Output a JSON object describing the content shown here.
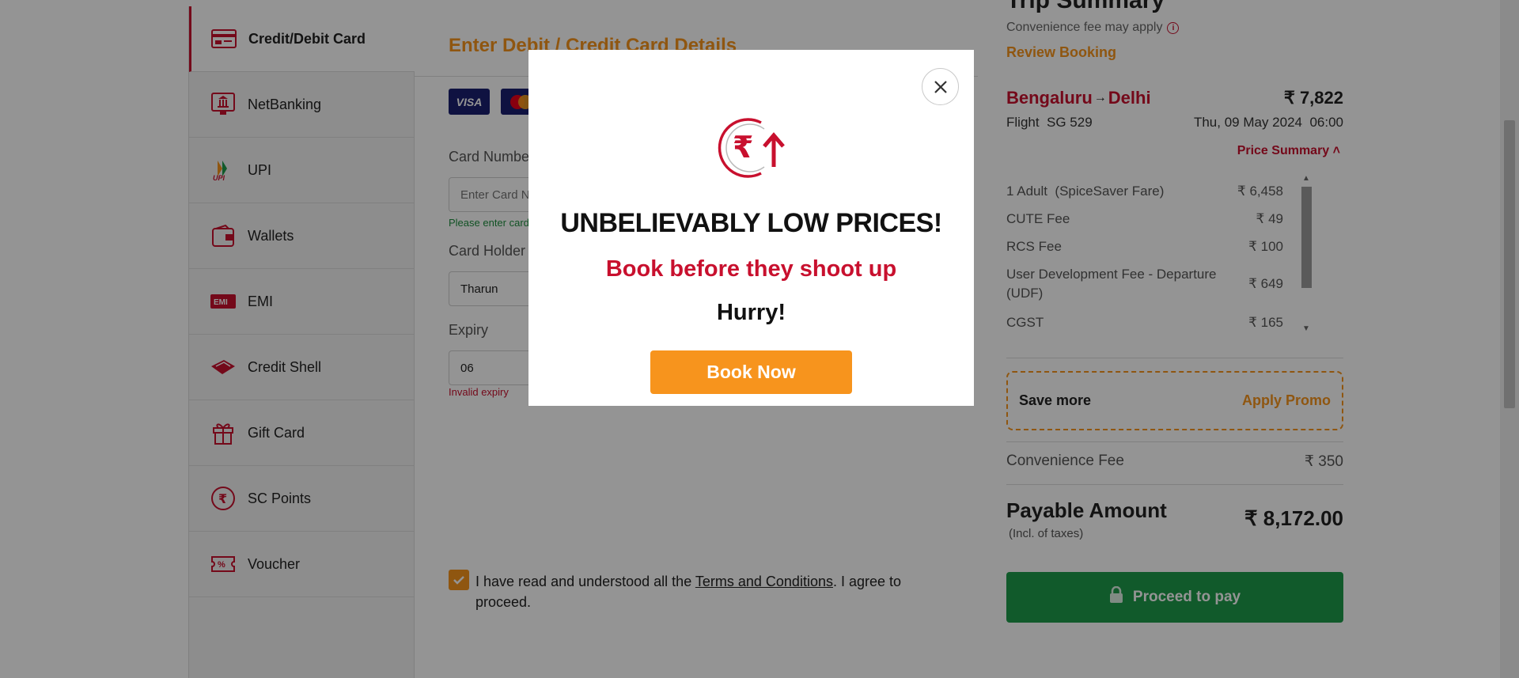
{
  "payment_methods": [
    {
      "label": "Credit/Debit Card",
      "icon": "credit-card-icon",
      "active": true
    },
    {
      "label": "NetBanking",
      "icon": "bank-icon",
      "active": false
    },
    {
      "label": "UPI",
      "icon": "upi-icon",
      "active": false
    },
    {
      "label": "Wallets",
      "icon": "wallet-icon",
      "active": false
    },
    {
      "label": "EMI",
      "icon": "emi-icon",
      "active": false
    },
    {
      "label": "Credit Shell",
      "icon": "credit-shell-icon",
      "active": false
    },
    {
      "label": "Gift Card",
      "icon": "gift-icon",
      "active": false
    },
    {
      "label": "SC Points",
      "icon": "rupee-coin-icon",
      "active": false
    },
    {
      "label": "Voucher",
      "icon": "voucher-icon",
      "active": false
    }
  ],
  "card_form": {
    "title": "Enter Debit / Credit Card Details",
    "card_logos": [
      "VISA",
      "Mastercard"
    ],
    "card_number_label": "Card Number",
    "card_number_placeholder": "Enter Card Number",
    "card_number_hint": "Please enter card number",
    "holder_label": "Card Holder Name",
    "holder_value": "Tharun",
    "expiry_label": "Expiry",
    "expiry_value": "06",
    "expiry_error": "Invalid expiry",
    "terms_prefix": "I have read and understood all the ",
    "terms_link": "Terms and Conditions",
    "terms_suffix": ". I agree to proceed.",
    "terms_checked": true
  },
  "summary": {
    "heading": "Trip Summary",
    "convenience_note": "Convenience fee may apply",
    "review_link": "Review Booking",
    "origin": "Bengaluru",
    "destination": "Delhi",
    "route_price": "₹ 7,822",
    "flight_label": "Flight  SG 529",
    "flight_date": "Thu, 09 May 2024  06:00",
    "price_summary_label": "Price Summary",
    "fare_rows": [
      {
        "label": "1 Adult  (SpiceSaver Fare)",
        "value": "₹ 6,458"
      },
      {
        "label": "CUTE Fee",
        "value": "₹ 49"
      },
      {
        "label": "RCS Fee",
        "value": "₹ 100"
      },
      {
        "label": "User Development Fee - Departure (UDF)",
        "value": "₹ 649"
      },
      {
        "label": "CGST",
        "value": "₹ 165"
      }
    ],
    "promo_save": "Save more",
    "promo_apply": "Apply Promo",
    "convenience_fee_label": "Convenience Fee",
    "convenience_fee_value": "₹ 350",
    "payable_label": "Payable Amount",
    "payable_sub": "(Incl. of taxes)",
    "payable_value": "₹ 8,172.00",
    "proceed_label": "Proceed to pay"
  },
  "modal": {
    "headline": "UNBELIEVABLY LOW PRICES!",
    "subheadline": "Book before they shoot up",
    "hurry": "Hurry!",
    "cta": "Book Now",
    "logo_glyph": "₹"
  },
  "colors": {
    "brand_red": "#c8102e",
    "brand_orange": "#f7941d",
    "proceed_green": "#1e9b4a",
    "overlay": "rgba(0,0,0,0.42)"
  }
}
